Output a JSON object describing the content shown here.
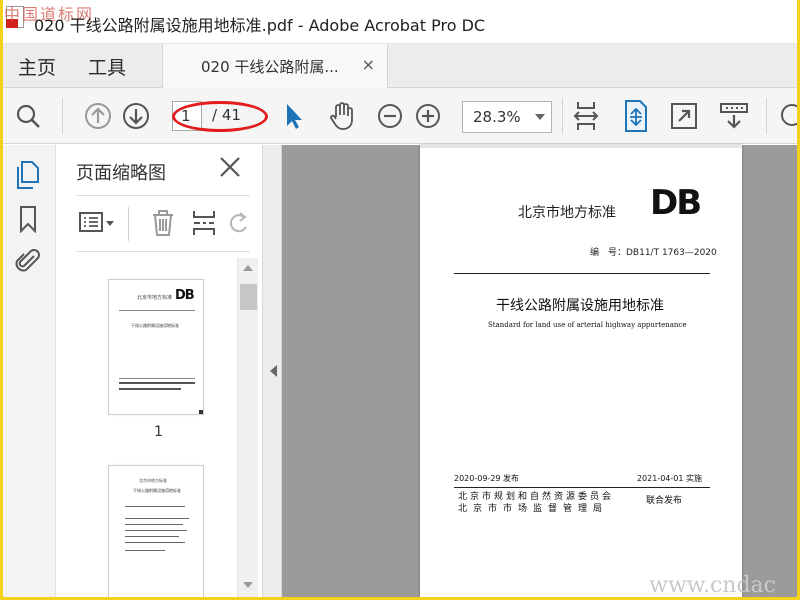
{
  "window": {
    "title": "020 干线公路附属设施用地标准.pdf - Adobe Acrobat Pro DC",
    "watermark_top": "中国道标网",
    "watermark_bottom": "www.cndac"
  },
  "tabs": {
    "home": "主页",
    "tools": "工具",
    "document": "020 干线公路附属...",
    "close_glyph": "×"
  },
  "toolbar": {
    "current_page": "1",
    "total_pages": "/ 41",
    "zoom": "28.3%"
  },
  "sidebar": {
    "panel_title": "页面缩略图"
  },
  "thumbnails": [
    {
      "label": "1",
      "preview_header": "北京市地方标准",
      "preview_db": "DB",
      "preview_title": "干线公路附属设施用地标准"
    },
    {
      "label": "",
      "preview_header": "北京市地方标准",
      "preview_title": "干线公路附属设施用地标准"
    }
  ],
  "document_page": {
    "header": "北京市地方标准",
    "db_mark": "DB",
    "std_no": "编　号：DB11/T 1763—2020",
    "title_cn": "干线公路附属设施用地标准",
    "title_en": "Standard for land use of arterial highway appurtenance",
    "issue_date": "2020-09-29 发布",
    "impl_date": "2021-04-01 实施",
    "org1": "北京市规划和自然资源委员会",
    "org2": "北京市市场监督管理局",
    "joint": "联合发布"
  },
  "colors": {
    "accent_blue": "#1f73b7",
    "highlight_red": "#e21c1c",
    "frame_yellow": "#f2d21b"
  }
}
